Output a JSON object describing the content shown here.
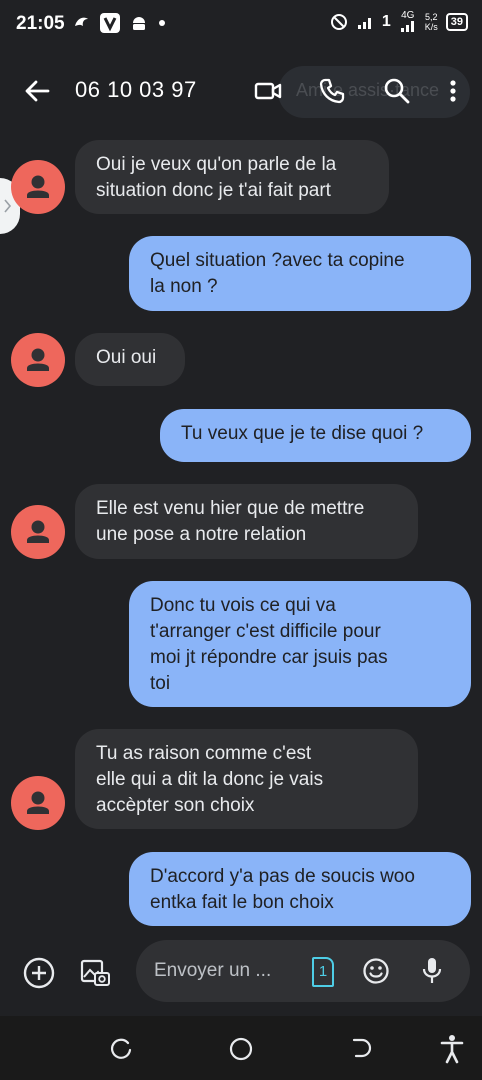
{
  "status_bar": {
    "time": "21:05",
    "network_label": "4G",
    "speed_value": "5,2",
    "speed_unit": "K/s",
    "battery": "39"
  },
  "app_bar": {
    "title": "06 10 03 97",
    "ghost_text": "Ami·e assis·tance"
  },
  "messages": [
    {
      "direction": "in",
      "text": "Oui je veux qu'on parle de la\nsituation donc je t'ai fait part"
    },
    {
      "direction": "out",
      "text": "Quel situation ?avec ta copine\nla non ?"
    },
    {
      "direction": "in",
      "text": "Oui oui"
    },
    {
      "direction": "out",
      "text": "Tu veux que je te dise quoi ?"
    },
    {
      "direction": "in",
      "text": "Elle est venu hier que de mettre\nune pose a notre relation"
    },
    {
      "direction": "out",
      "text": "Donc tu vois ce qui va\nt'arranger c'est difficile pour\nmoi jt répondre car jsuis pas\ntoi"
    },
    {
      "direction": "in",
      "text": "Tu as raison comme c'est\nelle qui a dit la donc je vais\naccèpter son choix"
    },
    {
      "direction": "out",
      "text": "D'accord y'a pas de soucis woo\nentka fait le bon choix"
    }
  ],
  "compose": {
    "placeholder": "Envoyer un ...",
    "sim_number": "1"
  },
  "colors": {
    "background": "#202124",
    "incoming_bubble": "#303134",
    "outgoing_bubble": "#8ab4f8",
    "avatar": "#ee675c",
    "sim_accent": "#4ecde6"
  },
  "icons": [
    "back-arrow-icon",
    "video-call-icon",
    "phone-icon",
    "search-icon",
    "more-vert-icon",
    "add-circle-icon",
    "gallery-icon",
    "sim-card-icon",
    "emoji-icon",
    "mic-icon",
    "recents-icon",
    "home-icon",
    "back-nav-icon",
    "accessibility-icon"
  ]
}
